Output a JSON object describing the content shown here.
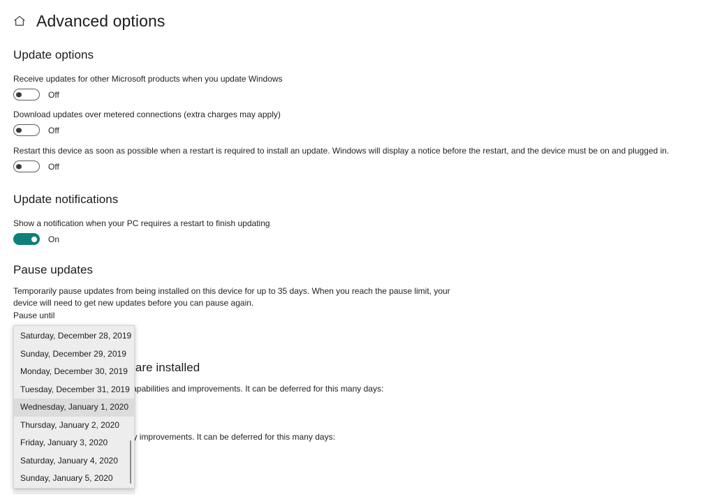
{
  "header": {
    "home_icon": "home-icon",
    "title": "Advanced options"
  },
  "sections": {
    "update_options": {
      "heading": "Update options",
      "settings": [
        {
          "description": "Receive updates for other Microsoft products when you update Windows",
          "state": "Off",
          "on": false
        },
        {
          "description": "Download updates over metered connections (extra charges may apply)",
          "state": "Off",
          "on": false
        },
        {
          "description": "Restart this device as soon as possible when a restart is required to install an update. Windows will display a notice before the restart, and the device must be on and plugged in.",
          "state": "Off",
          "on": false
        }
      ]
    },
    "update_notifications": {
      "heading": "Update notifications",
      "settings": [
        {
          "description": "Show a notification when your PC requires a restart to finish updating",
          "state": "On",
          "on": true
        }
      ]
    },
    "pause_updates": {
      "heading": "Pause updates",
      "description": "Temporarily pause updates from being installed on this device for up to 35 days. When you reach the pause limit, your device will need to get new updates before you can pause again.",
      "field_label": "Pause until"
    },
    "choose_when": {
      "heading": "Choose when updates are installed",
      "description_1": "A feature update includes new capabilities and improvements. It can be deferred for this many days:",
      "description_2": "A quality update includes security improvements. It can be deferred for this many days:"
    }
  },
  "pause_dropdown": {
    "selected_index": 4,
    "options": [
      "Saturday, December 28, 2019",
      "Sunday, December 29, 2019",
      "Monday, December 30, 2019",
      "Tuesday, December 31, 2019",
      "Wednesday, January 1, 2020",
      "Thursday, January 2, 2020",
      "Friday, January 3, 2020",
      "Saturday, January 4, 2020",
      "Sunday, January 5, 2020"
    ]
  },
  "colors": {
    "toggle_on": "#0f8079",
    "highlight": "#dcdcdc",
    "popup_background": "#ededed"
  }
}
